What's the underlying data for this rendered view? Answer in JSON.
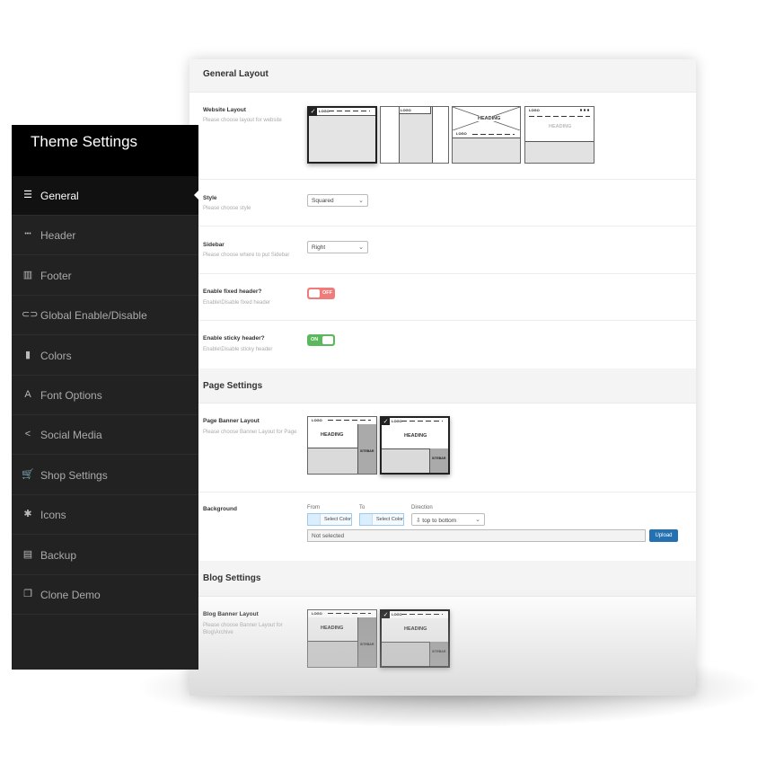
{
  "sidebar": {
    "title": "Theme Settings",
    "items": [
      {
        "label": "General",
        "icon": "sliders-icon",
        "glyph": "☰"
      },
      {
        "label": "Header",
        "icon": "dots-icon",
        "glyph": "•••"
      },
      {
        "label": "Footer",
        "icon": "layout-icon",
        "glyph": "▥"
      },
      {
        "label": "Global Enable/Disable",
        "icon": "toggle-icon",
        "glyph": "⊂⊃"
      },
      {
        "label": "Colors",
        "icon": "paintbrush-icon",
        "glyph": "▮"
      },
      {
        "label": "Font Options",
        "icon": "font-icon",
        "glyph": "A"
      },
      {
        "label": "Social Media",
        "icon": "share-icon",
        "glyph": "<"
      },
      {
        "label": "Shop Settings",
        "icon": "cart-icon",
        "glyph": "🛒"
      },
      {
        "label": "Icons",
        "icon": "icons-icon",
        "glyph": "✱"
      },
      {
        "label": "Backup",
        "icon": "file-icon",
        "glyph": "▤"
      },
      {
        "label": "Clone Demo",
        "icon": "clone-icon",
        "glyph": "❐"
      }
    ]
  },
  "general": {
    "heading": "General Layout",
    "website_layout": {
      "label": "Website Layout",
      "desc": "Please choose layout for website",
      "logo": "LOGO",
      "heading": "HEADING"
    },
    "style": {
      "label": "Style",
      "desc": "Please choose style",
      "value": "Squared"
    },
    "sidebar": {
      "label": "Sidebar",
      "desc": "Please choose where to put Sidebar",
      "value": "Right"
    },
    "fixed_header": {
      "label": "Enable fixed header?",
      "desc": "Enable\\Disable fixed header",
      "state": "OFF"
    },
    "sticky_header": {
      "label": "Enable sticky header?",
      "desc": "Enable\\Disable sticky header",
      "state": "ON"
    }
  },
  "page": {
    "heading": "Page Settings",
    "banner": {
      "label": "Page Banner Layout",
      "desc": "Please choose Banner Layout for Page",
      "logo": "LOGO",
      "heading": "HEADING",
      "sidebar": "SITEBAR"
    },
    "background": {
      "label": "Background",
      "from_label": "From",
      "to_label": "To",
      "direction_label": "Direction",
      "select_color": "Select Color",
      "direction_value": "top to bottom",
      "file_value": "Not selected",
      "upload": "Upload"
    }
  },
  "blog": {
    "heading": "Blog Settings",
    "banner": {
      "label": "Blog Banner Layout",
      "desc": "Please choose Banner Layout for Blog\\Archive",
      "logo": "LOGO",
      "heading": "HEADING",
      "sidebar": "SITEBAR"
    }
  }
}
